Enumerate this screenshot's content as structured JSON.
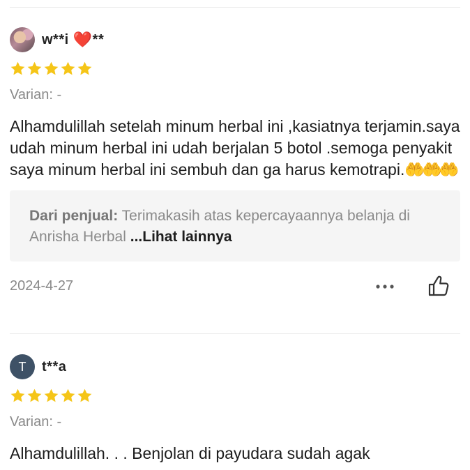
{
  "reviews": [
    {
      "username": "w**i",
      "username_suffix": "**",
      "heart": "❤️",
      "rating": 5,
      "variant": "Varian: -",
      "text": "Alhamdulillah setelah minum herbal ini ,kasiatnya terjamin.saya udah minum herbal ini udah berjalan 5 botol .semoga penyakit saya minum herbal ini sembuh dan ga harus kemotrapi.",
      "emoji": "🤲🤲🤲",
      "seller_label": "Dari penjual:",
      "seller_text": "Terimakasih atas kepercayaannya belanja di Anrisha Herbal",
      "see_more": "...Lihat lainnya",
      "date": "2024-4-27"
    },
    {
      "avatar_letter": "T",
      "username": "t**a",
      "rating": 5,
      "variant": "Varian: -",
      "text": "Alhamdulillah. . . Benjolan di payudara sudah agak"
    }
  ],
  "icons": {
    "more": "more-dots-icon",
    "like": "thumbs-up-icon",
    "star": "star-icon"
  },
  "colors": {
    "star": "#f5c518",
    "avatar_letter_bg": "#3e5166",
    "seller_box_bg": "#f5f5f5",
    "muted_text": "#8a8a8a"
  }
}
